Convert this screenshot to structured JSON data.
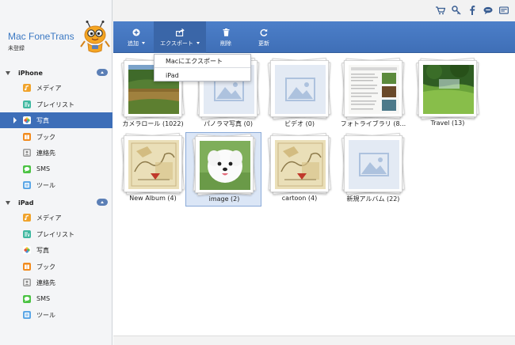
{
  "app": {
    "name": "Mac FoneTrans",
    "status": "未登録"
  },
  "top_icons": [
    "cart-icon",
    "key-icon",
    "facebook-icon",
    "chat-icon",
    "feedback-icon"
  ],
  "toolbar": {
    "add": "追加",
    "export": "エクスポート",
    "delete": "削除",
    "refresh": "更新"
  },
  "export_menu": {
    "items": [
      "Macにエクスポート",
      "iPad"
    ]
  },
  "devices": [
    {
      "name": "iPhone",
      "items": [
        {
          "label": "メディア",
          "icon": "media-icon"
        },
        {
          "label": "プレイリスト",
          "icon": "playlist-icon"
        },
        {
          "label": "写真",
          "icon": "photos-icon",
          "active": true
        },
        {
          "label": "ブック",
          "icon": "book-icon"
        },
        {
          "label": "連絡先",
          "icon": "contacts-icon"
        },
        {
          "label": "SMS",
          "icon": "sms-icon"
        },
        {
          "label": "ツール",
          "icon": "tools-icon"
        }
      ]
    },
    {
      "name": "iPad",
      "items": [
        {
          "label": "メディア",
          "icon": "media-icon"
        },
        {
          "label": "プレイリスト",
          "icon": "playlist-icon"
        },
        {
          "label": "写真",
          "icon": "photos-icon"
        },
        {
          "label": "ブック",
          "icon": "book-icon"
        },
        {
          "label": "連絡先",
          "icon": "contacts-icon"
        },
        {
          "label": "SMS",
          "icon": "sms-icon"
        },
        {
          "label": "ツール",
          "icon": "tools-icon"
        }
      ]
    }
  ],
  "albums": [
    {
      "label": "カメラロール (1022)",
      "thumb": "lake"
    },
    {
      "label": "パノラマ写真 (0)",
      "thumb": "placeholder"
    },
    {
      "label": "ビデオ (0)",
      "thumb": "placeholder"
    },
    {
      "label": "フォトライブラリ (8...",
      "thumb": "document"
    },
    {
      "label": "Travel (13)",
      "thumb": "meadow"
    },
    {
      "label": "New Album (4)",
      "thumb": "sketch"
    },
    {
      "label": "image (2)",
      "thumb": "dog",
      "selected": true
    },
    {
      "label": "cartoon (4)",
      "thumb": "sketch"
    },
    {
      "label": "新規アルバム (22)",
      "thumb": "placeholder"
    }
  ],
  "colors": {
    "accent": "#3d6eb8",
    "toolbar": "#4c7fc9",
    "brand": "#3a78c3"
  }
}
